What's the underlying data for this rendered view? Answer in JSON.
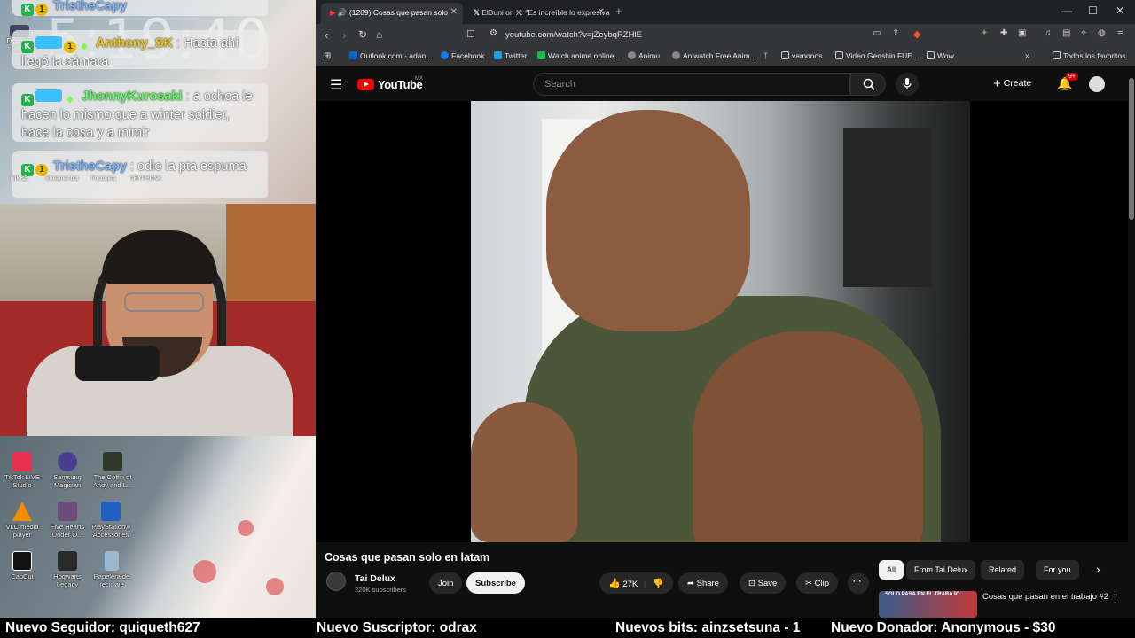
{
  "overlay": {
    "clock": "5:19:40",
    "top_icon_label": "Digimon Story",
    "chat": [
      {
        "user": "TristheCapy",
        "message": ""
      },
      {
        "user": "Anthony_SK",
        "message": " : Hasta ahí llegó la cámara"
      },
      {
        "user": "JhonnyKurosaki",
        "message": " : a ochoa le hacen lo mismo que a winter soldier, hace la cosa y a mimir"
      },
      {
        "user": "TristheCapy",
        "message": " : odio la pta espuma"
      }
    ],
    "chat_icon_labels": [
      "NIKKE",
      "Streamer.bot",
      "Photopea",
      "CRYPHUNK"
    ],
    "desktop_icons": [
      {
        "label": "TikTok LIVE Studio",
        "color": "#e8304f"
      },
      {
        "label": "Samsung Magician",
        "color": "#4a3f8f"
      },
      {
        "label": "The Coffin of Andy and L...",
        "color": "#2f3a2a"
      },
      {
        "label": "VLC media player",
        "color": "#f28c00"
      },
      {
        "label": "Five Hearts Under O...",
        "color": "#6c4a7a"
      },
      {
        "label": "PlayStation® Accessories",
        "color": "#1f5fbf"
      },
      {
        "label": "CapCut",
        "color": "#111111"
      },
      {
        "label": "Hogwarts Legacy",
        "color": "#2a2a2a"
      },
      {
        "label": "Papelera de reciclaje",
        "color": "#9ab8d0"
      }
    ]
  },
  "browser": {
    "tabs": [
      {
        "title": "(1289) Cosas que pasan solo",
        "active": true
      },
      {
        "title": "ElBuni on X: \"Es increíble lo expresiva",
        "active": false
      }
    ],
    "new_tab": "+",
    "window_controls": [
      "—",
      "☐",
      "✕"
    ],
    "url": "youtube.com/watch?v=jZeybqRZHlE",
    "bookmarks": [
      {
        "label": "Outlook.com - adan...",
        "color": "#0a64c8"
      },
      {
        "label": "Facebook",
        "color": "#1877f2"
      },
      {
        "label": "Twitter",
        "color": "#1d9bf0"
      },
      {
        "label": "Watch anime online...",
        "color": "#1db954"
      },
      {
        "label": "Animu",
        "color": "#888888"
      },
      {
        "label": "Aniwatch Free Anim...",
        "color": "#888888"
      },
      {
        "label": "vamonos",
        "color": "#cfcfcf"
      },
      {
        "label": "Video Genshin FUE...",
        "color": "#cfcfcf"
      },
      {
        "label": "Wow",
        "color": "#cfcfcf"
      }
    ],
    "favorites_label": "Todos los favoritos"
  },
  "youtube": {
    "logo_text": "YouTube",
    "country": "MX",
    "search_placeholder": "Search",
    "create_label": "Create",
    "notification_count": "9+",
    "video_title": "Cosas que pasan solo en latam",
    "channel_name": "Tai Delux",
    "channel_subs": "220K subscribers",
    "join_label": "Join",
    "subscribe_label": "Subscribe",
    "like_count": "27K",
    "share_label": "Share",
    "save_label": "Save",
    "clip_label": "Clip",
    "chips": [
      "All",
      "From Tai Delux",
      "Related",
      "For you"
    ],
    "rec_thumb_text": "SOLO PASA EN EL TRABAJO",
    "rec_title": "Cosas que pasan en el trabajo #2"
  },
  "ticker": {
    "follower": "Nuevo Seguidor: quiqueth627",
    "subscriber": "Nuevo Suscriptor: odrax",
    "bits": "Nuevos bits: ainzsetsuna - 1",
    "donor": "Nuevo Donador: Anonymous - $30"
  },
  "colors": {
    "youtube_red": "#ff0000",
    "ticker_bg": "#000000",
    "bookmark_bar": "#35363a"
  }
}
